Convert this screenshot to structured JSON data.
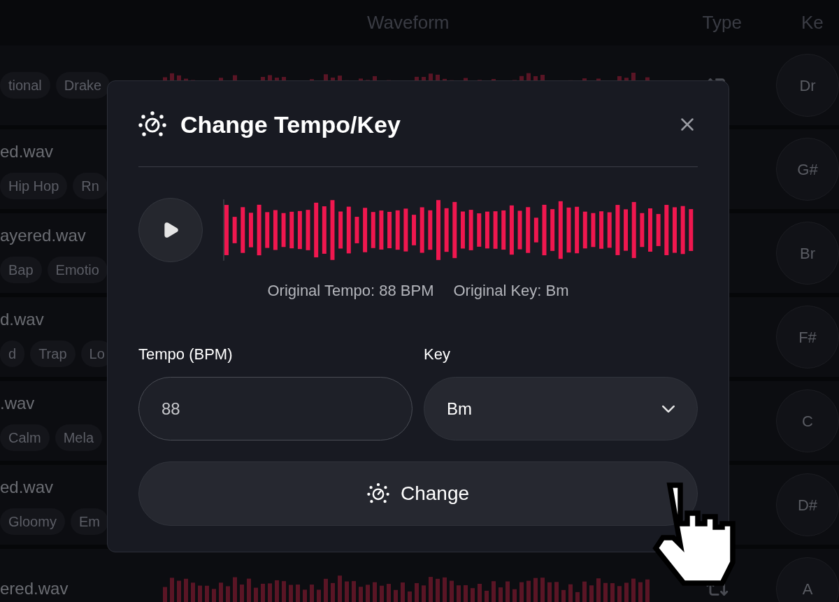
{
  "table": {
    "columns": [
      {
        "label": "Waveform"
      },
      {
        "label": "Type"
      },
      {
        "label": "Ke"
      }
    ],
    "rows": [
      {
        "name": "",
        "tags": [
          "tional",
          "Drake"
        ],
        "key": "Dr"
      },
      {
        "name": "ed.wav",
        "tags": [
          "Hip Hop",
          "Rn"
        ],
        "key": "G#"
      },
      {
        "name": "ayered.wav",
        "tags": [
          "Bap",
          "Emotio"
        ],
        "key": "Br"
      },
      {
        "name": "d.wav",
        "tags": [
          "d",
          "Trap",
          "Lo"
        ],
        "key": "F#"
      },
      {
        "name": ".wav",
        "tags": [
          "Calm",
          "Mela"
        ],
        "key": "C"
      },
      {
        "name": "ed.wav",
        "tags": [
          "Gloomy",
          "Em"
        ],
        "key": "D#"
      },
      {
        "name": "ered.wav",
        "tags": [],
        "key": "A"
      }
    ]
  },
  "dialog": {
    "title": "Change Tempo/Key",
    "original_tempo": "Original Tempo: 88 BPM",
    "original_key": "Original Key: Bm",
    "tempo_label": "Tempo (BPM)",
    "tempo_value": "88",
    "key_label": "Key",
    "key_value": "Bm",
    "button": "Change"
  }
}
